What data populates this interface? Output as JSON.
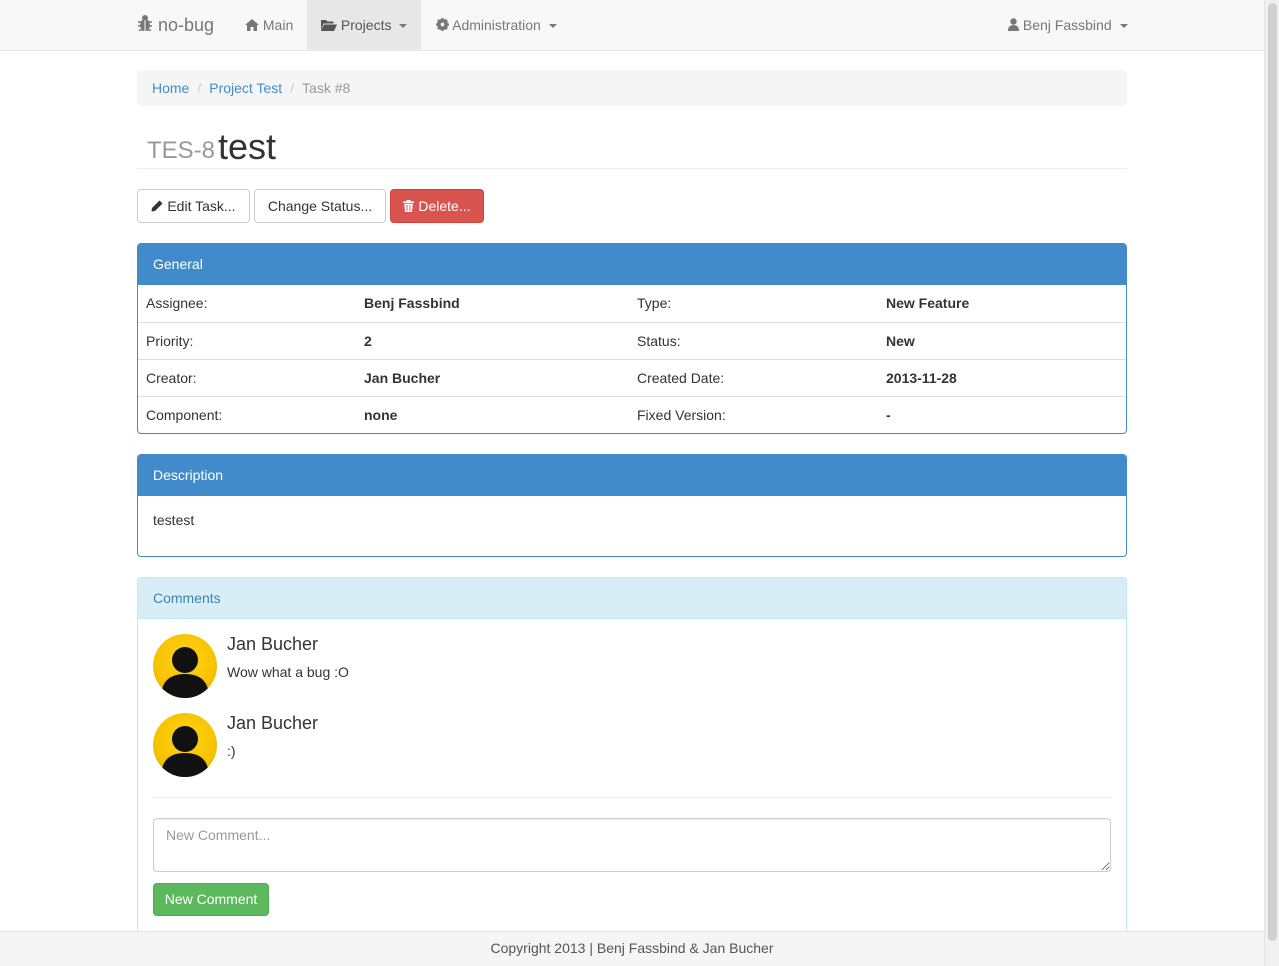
{
  "navbar": {
    "brand": "no-bug",
    "main_label": "Main",
    "projects_label": "Projects",
    "administration_label": "Administration",
    "user_label": "Benj Fassbind"
  },
  "breadcrumb": {
    "home": "Home",
    "project": "Project Test",
    "current": "Task #8"
  },
  "task": {
    "key": "TES-8",
    "title": "test"
  },
  "actions": {
    "edit_label": "Edit Task...",
    "change_status_label": "Change Status...",
    "delete_label": "Delete..."
  },
  "general": {
    "heading": "General",
    "rows": [
      {
        "label1": "Assignee:",
        "value1": "Benj Fassbind",
        "label2": "Type:",
        "value2": "New Feature"
      },
      {
        "label1": "Priority:",
        "value1": "2",
        "label2": "Status:",
        "value2": "New"
      },
      {
        "label1": "Creator:",
        "value1": "Jan Bucher",
        "label2": "Created Date:",
        "value2": "2013-11-28"
      },
      {
        "label1": "Component:",
        "value1": "none",
        "label2": "Fixed Version:",
        "value2": "-"
      }
    ]
  },
  "description": {
    "heading": "Description",
    "text": "testest"
  },
  "comments": {
    "heading": "Comments",
    "items": [
      {
        "author": "Jan Bucher",
        "text": "Wow what a bug :O"
      },
      {
        "author": "Jan Bucher",
        "text": ":)"
      }
    ],
    "input_placeholder": "New Comment...",
    "submit_label": "New Comment"
  },
  "footer": {
    "text": "Copyright 2013 | Benj Fassbind & Jan Bucher"
  },
  "colors": {
    "primary": "#428bca",
    "danger": "#d9534f",
    "success": "#5cb85c",
    "info_bg": "#d9edf7",
    "avatar": "#f7c300"
  },
  "icons": {
    "brand": "bug-icon",
    "main": "home-icon",
    "projects": "folder-open-icon",
    "administration": "gear-icon",
    "user": "user-icon",
    "edit": "pencil-icon",
    "delete": "trash-icon"
  }
}
